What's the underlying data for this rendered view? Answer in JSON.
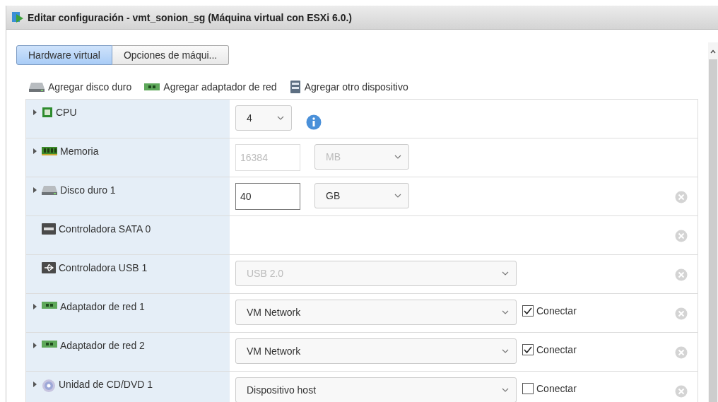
{
  "window": {
    "title": "Editar configuración - vmt_sonion_sg (Máquina virtual con ESXi 6.0.)"
  },
  "tabs": [
    {
      "label": "Hardware virtual",
      "selected": true
    },
    {
      "label": "Opciones de máqui...",
      "selected": false
    }
  ],
  "toolbar": [
    {
      "kind": "disk",
      "label": "Agregar disco duro"
    },
    {
      "kind": "network",
      "label": "Agregar adaptador de red"
    },
    {
      "kind": "device",
      "label": "Agregar otro dispositivo"
    }
  ],
  "devices": [
    {
      "kind": "cpu",
      "label": "CPU",
      "expandable": true,
      "removable": false,
      "controls": [
        {
          "kind": "select",
          "value": "4",
          "disabled": false
        },
        {
          "kind": "info"
        }
      ]
    },
    {
      "kind": "memory",
      "label": "Memoria",
      "expandable": true,
      "removable": false,
      "controls": [
        {
          "kind": "input",
          "value": "16384",
          "disabled": true
        },
        {
          "kind": "select",
          "value": "MB",
          "disabled": true
        }
      ]
    },
    {
      "kind": "disk",
      "label": "Disco duro 1",
      "expandable": true,
      "removable": true,
      "controls": [
        {
          "kind": "input",
          "value": "40",
          "disabled": false
        },
        {
          "kind": "select",
          "value": "GB",
          "disabled": false
        }
      ]
    },
    {
      "kind": "sata",
      "label": "Controladora SATA 0",
      "expandable": false,
      "removable": true
    },
    {
      "kind": "usb",
      "label": "Controladora USB 1",
      "expandable": false,
      "removable": true,
      "controls": [
        {
          "kind": "select",
          "value": "USB 2.0",
          "disabled": true
        }
      ]
    },
    {
      "kind": "network",
      "label": "Adaptador de red 1",
      "expandable": true,
      "removable": true,
      "controls": [
        {
          "kind": "select",
          "value": "VM Network",
          "disabled": false
        },
        {
          "kind": "checkbox",
          "label": "Conectar",
          "checked": true
        }
      ]
    },
    {
      "kind": "network",
      "label": "Adaptador de red 2",
      "expandable": true,
      "removable": true,
      "controls": [
        {
          "kind": "select",
          "value": "VM Network",
          "disabled": false
        },
        {
          "kind": "checkbox",
          "label": "Conectar",
          "checked": true
        }
      ]
    },
    {
      "kind": "cdrom",
      "label": "Unidad de CD/DVD 1",
      "expandable": true,
      "removable": true,
      "controls": [
        {
          "kind": "select",
          "value": "Dispositivo host",
          "disabled": false
        },
        {
          "kind": "checkbox",
          "label": "Conectar",
          "checked": false
        }
      ]
    }
  ]
}
